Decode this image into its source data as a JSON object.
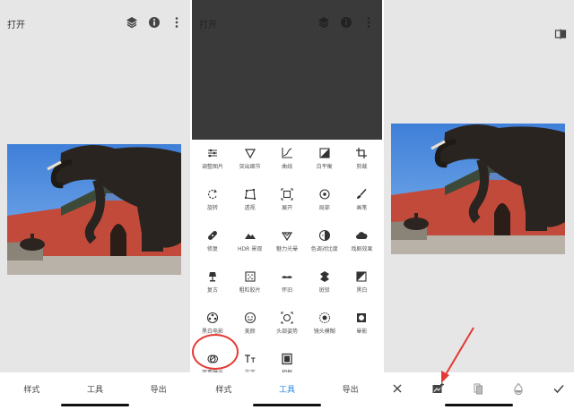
{
  "panel1": {
    "title": "打开",
    "tabs": [
      "样式",
      "工具",
      "导出"
    ]
  },
  "panel2": {
    "title": "打开",
    "tools": [
      {
        "label": "调整图片",
        "icon": "tune-sliders-icon"
      },
      {
        "label": "突出细节",
        "icon": "details-triangle-icon"
      },
      {
        "label": "曲线",
        "icon": "curves-icon"
      },
      {
        "label": "白平衡",
        "icon": "white-balance-icon"
      },
      {
        "label": "剪裁",
        "icon": "crop-icon"
      },
      {
        "label": "旋转",
        "icon": "rotate-icon"
      },
      {
        "label": "透视",
        "icon": "perspective-icon"
      },
      {
        "label": "展开",
        "icon": "expand-icon"
      },
      {
        "label": "局部",
        "icon": "selective-target-icon"
      },
      {
        "label": "画笔",
        "icon": "brush-icon"
      },
      {
        "label": "修复",
        "icon": "healing-bandage-icon"
      },
      {
        "label": "HDR 景观",
        "icon": "hdr-mountain-icon"
      },
      {
        "label": "魅力光晕",
        "icon": "glamour-glow-icon"
      },
      {
        "label": "色调对比度",
        "icon": "tonal-contrast-icon"
      },
      {
        "label": "戏剧效果",
        "icon": "drama-cloud-icon"
      },
      {
        "label": "复古",
        "icon": "vintage-lamp-icon"
      },
      {
        "label": "粗粒胶片",
        "icon": "grainy-film-icon"
      },
      {
        "label": "怀旧",
        "icon": "retrolux-mustache-icon"
      },
      {
        "label": "斑驳",
        "icon": "grunge-icon"
      },
      {
        "label": "黑白",
        "icon": "black-white-icon"
      },
      {
        "label": "黑白电影",
        "icon": "noir-film-reel-icon"
      },
      {
        "label": "美颜",
        "icon": "face-glamour-icon"
      },
      {
        "label": "头部姿势",
        "icon": "head-pose-icon"
      },
      {
        "label": "镜头模糊",
        "icon": "lens-blur-icon"
      },
      {
        "label": "晕影",
        "icon": "vignette-icon"
      },
      {
        "label": "双重曝光",
        "icon": "double-exposure-icon"
      },
      {
        "label": "文字",
        "icon": "text-tt-icon"
      },
      {
        "label": "相框",
        "icon": "frame-icon"
      }
    ],
    "tabs": [
      "样式",
      "工具",
      "导出"
    ],
    "active_tab": "工具"
  },
  "panel3": {
    "bottom_icons": [
      "close-icon",
      "add-image-icon",
      "blend-mode-icon",
      "opacity-drop-icon",
      "check-icon"
    ]
  },
  "colors": {
    "accent": "#1e88e5",
    "annotation": "#e53935",
    "dark_area": "#3a3a3a"
  }
}
